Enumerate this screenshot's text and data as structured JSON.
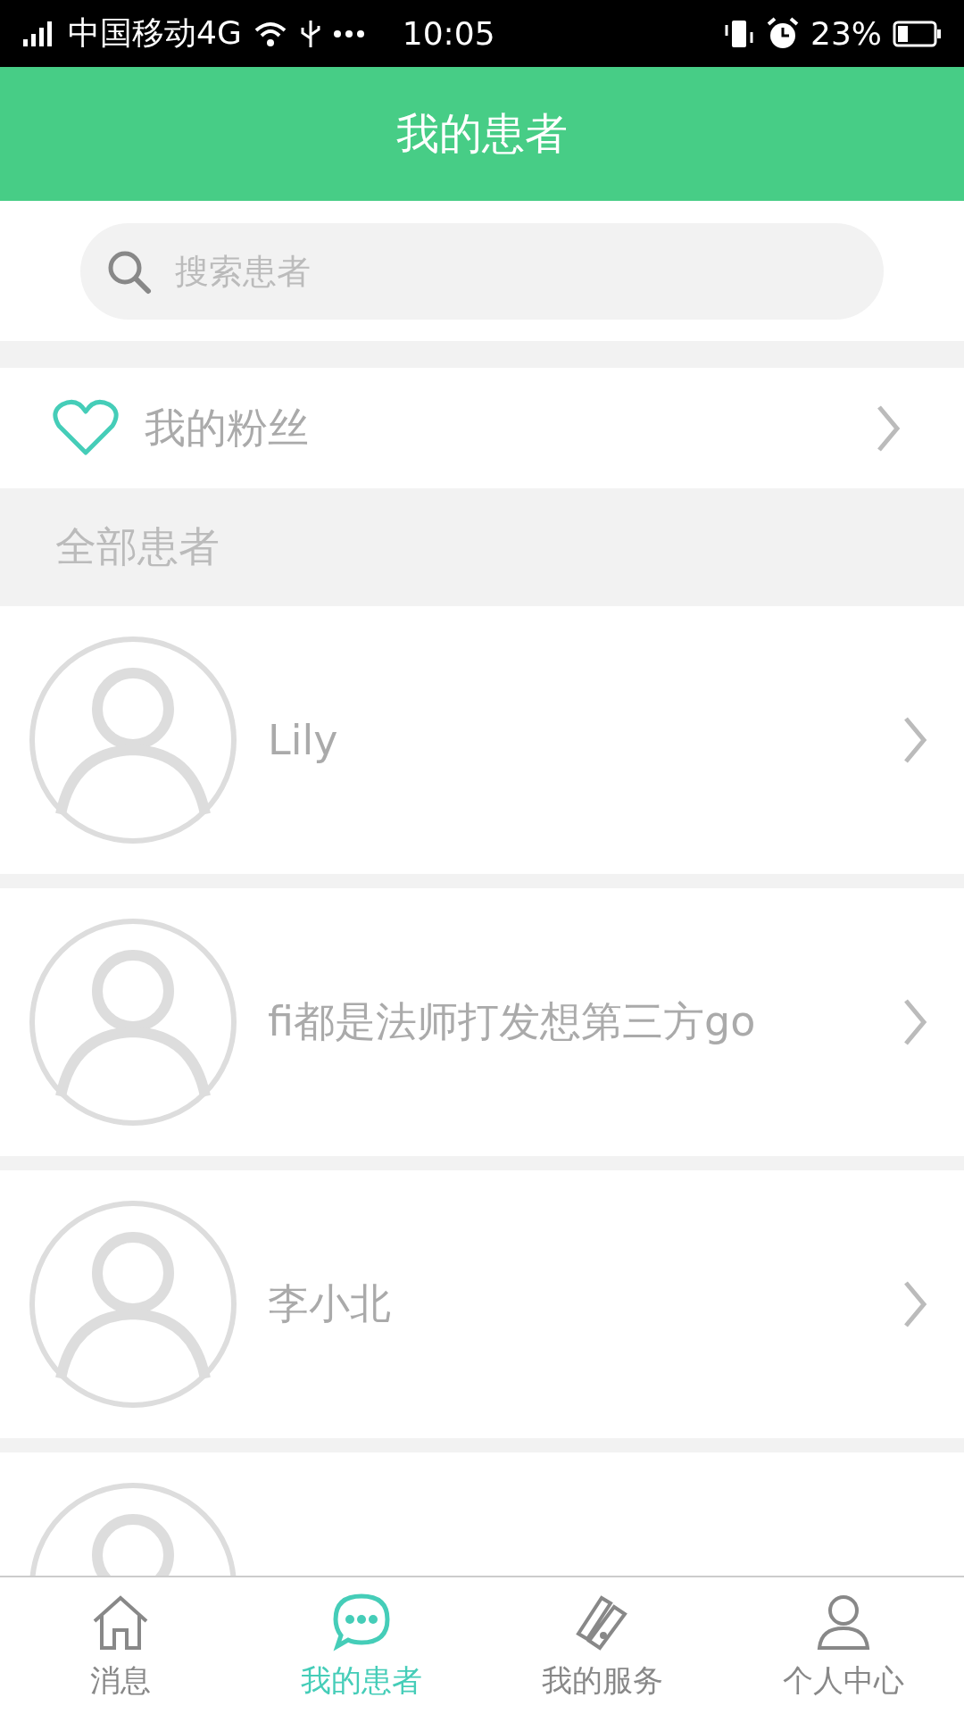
{
  "status_bar": {
    "carrier": "中国移动4G",
    "time": "10:05",
    "battery": "23%"
  },
  "header": {
    "title": "我的患者"
  },
  "search": {
    "placeholder": "搜索患者"
  },
  "fans": {
    "label": "我的粉丝"
  },
  "section": {
    "title": "全部患者"
  },
  "patients": [
    {
      "name": "Lily"
    },
    {
      "name": "fi都是法师打发想第三方go"
    },
    {
      "name": "李小北"
    }
  ],
  "tabs": [
    {
      "label": "消息",
      "selected": false,
      "kind": "home"
    },
    {
      "label": "我的患者",
      "selected": true,
      "kind": "chat"
    },
    {
      "label": "我的服务",
      "selected": false,
      "kind": "cards"
    },
    {
      "label": "个人中心",
      "selected": false,
      "kind": "person"
    }
  ]
}
